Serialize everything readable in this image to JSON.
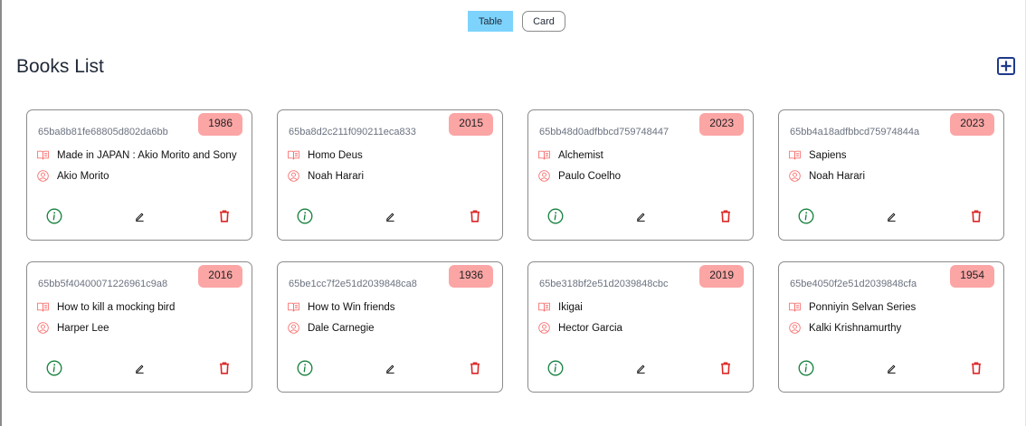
{
  "toolbar": {
    "table_label": "Table",
    "card_label": "Card"
  },
  "page": {
    "title": "Books List"
  },
  "icons": {
    "add": "plus-square-icon",
    "title": "open-book-icon",
    "author": "user-circle-icon",
    "info": "info-circle-icon",
    "edit": "pencil-icon",
    "delete": "trash-icon"
  },
  "colors": {
    "toggle_bg": "#7dd3fc",
    "year_badge": "#fca5a5",
    "info": "#15803d",
    "delete": "#dc2626",
    "add": "#1e3a8a",
    "row_icon": "#f87171"
  },
  "books": [
    {
      "id": "65ba8b81fe68805d802da6bb",
      "year": "1986",
      "title": "Made in JAPAN : Akio Morito and Sony",
      "author": "Akio Morito"
    },
    {
      "id": "65ba8d2c211f090211eca833",
      "year": "2015",
      "title": "Homo Deus",
      "author": "Noah Harari"
    },
    {
      "id": "65bb48d0adfbbcd759748447",
      "year": "2023",
      "title": "Alchemist",
      "author": "Paulo Coelho"
    },
    {
      "id": "65bb4a18adfbbcd75974844a",
      "year": "2023",
      "title": "Sapiens",
      "author": "Noah Harari"
    },
    {
      "id": "65bb5f40400071226961c9a8",
      "year": "2016",
      "title": "How to kill a mocking bird",
      "author": "Harper Lee"
    },
    {
      "id": "65be1cc7f2e51d2039848ca8",
      "year": "1936",
      "title": "How to Win friends",
      "author": "Dale Carnegie"
    },
    {
      "id": "65be318bf2e51d2039848cbc",
      "year": "2019",
      "title": "Ikigai",
      "author": "Hector Garcia"
    },
    {
      "id": "65be4050f2e51d2039848cfa",
      "year": "1954",
      "title": "Ponniyin Selvan Series",
      "author": "Kalki Krishnamurthy"
    }
  ]
}
